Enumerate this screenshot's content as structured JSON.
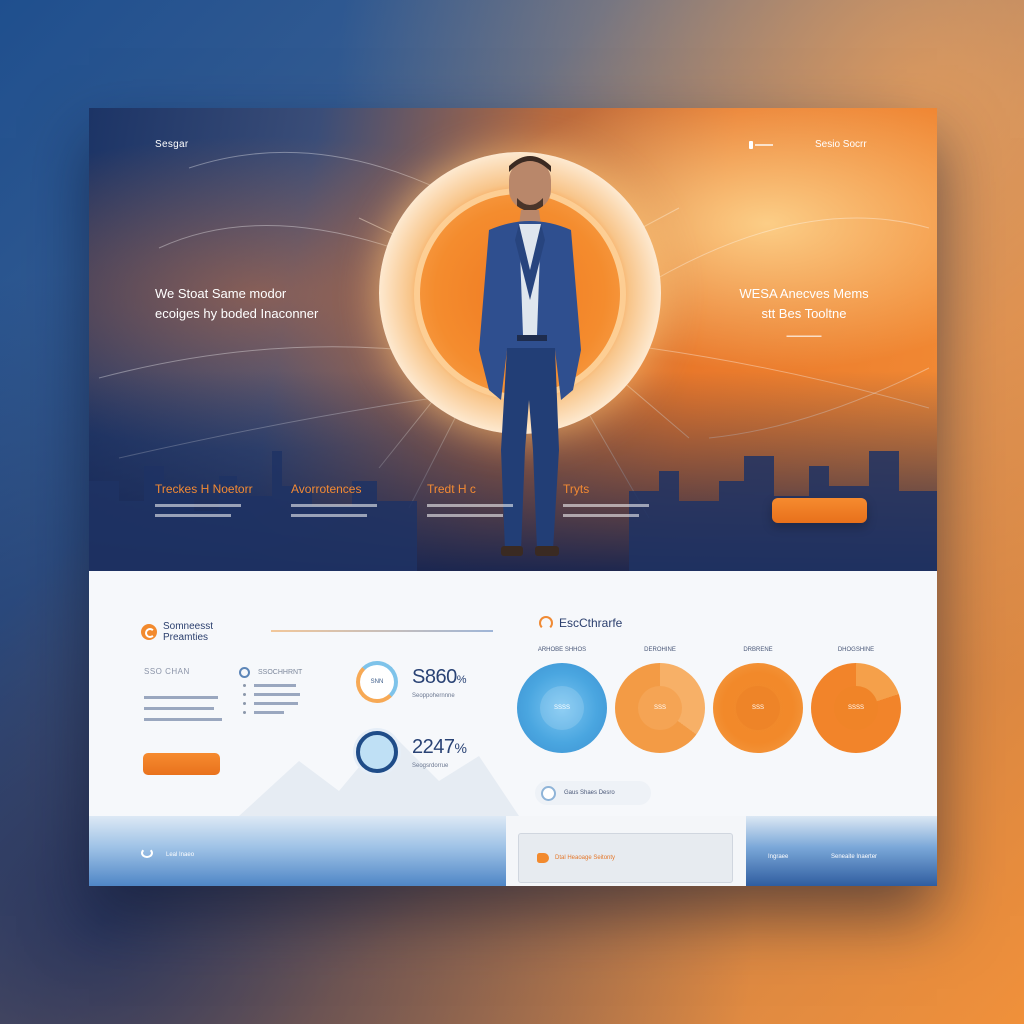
{
  "header": {
    "logo": "Sesgar",
    "nav_right_label": "Sesio Socrr"
  },
  "hero": {
    "left_line1": "We Stoat Same modor",
    "left_line2": "ecoiges hy boded Inaconner",
    "right_line1": "WESA Anecves Mems",
    "right_line2": "stt Bes Tooltne",
    "features": [
      {
        "title": "Treckes H Noetorr"
      },
      {
        "title": "Avorrotences"
      },
      {
        "title": "Tredt H c"
      },
      {
        "title": "Tryts"
      }
    ],
    "cta_label": ""
  },
  "services": {
    "title_line1": "Somneesst",
    "title_line2": "Preamties",
    "small_label": "SSO CHAN",
    "list_header": "SSOCHHRNT",
    "button_label": ""
  },
  "stats": [
    {
      "gauge_label": "SNN",
      "value": "S860",
      "suffix": "%",
      "caption": "Seoppohernnne"
    },
    {
      "gauge_label": "",
      "value": "2247",
      "suffix": "%",
      "caption": "Seogsrdorrue"
    }
  ],
  "right_panel": {
    "title": "EscCthrarfe",
    "pies": [
      {
        "label": "ARHOBE SHHOS",
        "center": "SSSS",
        "color": "#4aa6e0"
      },
      {
        "label": "DEROHINE",
        "center": "SSS",
        "color": "#f39b45"
      },
      {
        "label": "DRBRENE",
        "center": "SSS",
        "color": "#f2892a"
      },
      {
        "label": "DHOGSHINE",
        "center": "SSSS",
        "color": "#f2842a"
      }
    ],
    "pill_label": "Gaus Shaes Desro"
  },
  "footer": {
    "left_label": "Leal Inaeo",
    "mid_label": "Dtal Heaoage Seitonty",
    "right_label1": "Ingraee",
    "right_label2": "Seneaite Inaerter"
  },
  "colors": {
    "accent_orange": "#f28a2e",
    "navy": "#1c3466",
    "blue": "#4aa6e0"
  }
}
